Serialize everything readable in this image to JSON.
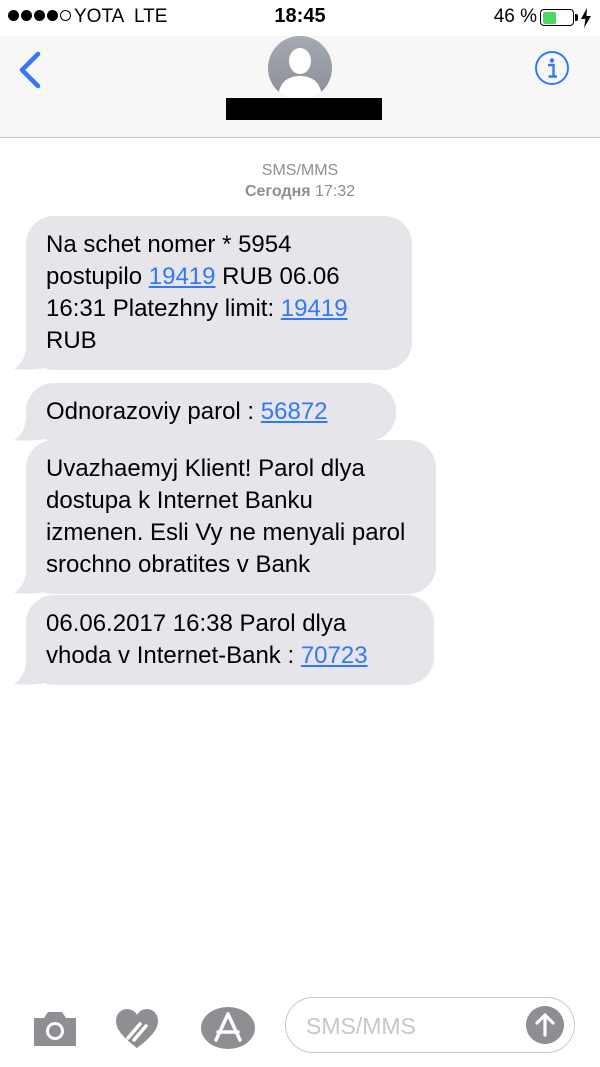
{
  "status_bar": {
    "carrier": "YOTA",
    "network": "LTE",
    "time": "18:45",
    "battery_percent": "46 %",
    "battery_level": 0.46,
    "signal_bars_filled": 4,
    "signal_bars_total": 5
  },
  "nav": {
    "back_icon": "chevron-left-icon",
    "info_icon": "info-icon"
  },
  "thread": {
    "service_label": "SMS/MMS",
    "day_label": "Сегодня",
    "time_label": "17:32"
  },
  "messages": [
    {
      "segments": [
        {
          "text": "Na schet nomer * 5954 postupilo  "
        },
        {
          "text": "19419",
          "link": true
        },
        {
          "text": " RUB 06.06 16:31 Platezhny limit: "
        },
        {
          "text": "19419",
          "link": true
        },
        {
          "text": " RUB"
        }
      ]
    },
    {
      "segments": [
        {
          "text": "Odnorazoviy parol  : "
        },
        {
          "text": "56872",
          "link": true
        }
      ]
    },
    {
      "segments": [
        {
          "text": "Uvazhaemyj Klient! Parol dlya dostupa k Internet Banku izmenen. Esli Vy ne menyali parol srochno obratites v Bank"
        }
      ]
    },
    {
      "segments": [
        {
          "text": "06.06.2017 16:38 Parol dlya vhoda v Internet-Bank : "
        },
        {
          "text": "70723",
          "link": true
        }
      ]
    }
  ],
  "composer": {
    "placeholder": "SMS/MMS",
    "camera_icon": "camera-icon",
    "digital_touch_icon": "digital-touch-icon",
    "app_store_icon": "app-store-icon",
    "send_icon": "send-arrow-icon"
  },
  "colors": {
    "link": "#3478f6",
    "bubble_incoming": "#e5e5ea",
    "ios_blue": "#3478f6",
    "battery": "#4cd964"
  }
}
